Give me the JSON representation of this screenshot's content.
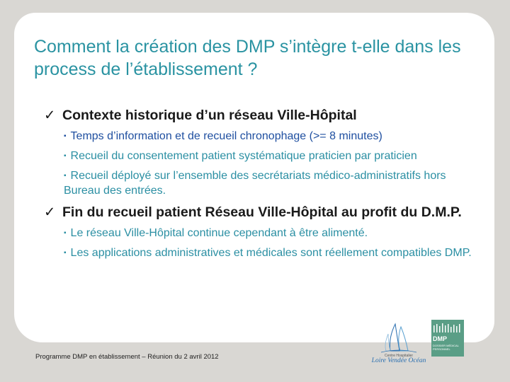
{
  "slide": {
    "title": "Comment la création des DMP s’intègre t-elle dans les process de l’établissement ?",
    "sections": [
      {
        "bullet": "✓",
        "heading": "Contexte historique d’un réseau Ville-Hôpital",
        "items": [
          "Temps d’information et de recueil chronophage (>= 8 minutes)",
          "Recueil du consentement patient systématique praticien par praticien",
          "Recueil déployé sur l’ensemble des secrétariats médico-administratifs hors Bureau des entrées."
        ]
      },
      {
        "bullet": "✓",
        "heading": "Fin du recueil patient Réseau Ville-Hôpital au profit du D.M.P.",
        "items": [
          "Le réseau Ville-Hôpital continue cependant à être alimenté.",
          "Les applications administratives et médicales sont réellement compatibles DMP."
        ]
      }
    ],
    "sub_bullet": "▪",
    "footer": "Programme DMP en établissement – Réunion du 2 avril 2012"
  },
  "logos": {
    "hospital": {
      "caption": "Centre Hospitalier",
      "name": "Loire Vendée Océan"
    },
    "dmp": {
      "text": "DMP",
      "subtitle": "DOSSIER MÉDICAL PERSONNEL"
    }
  },
  "colors": {
    "title": "#2a93a2",
    "sub_bullet_text": "#2b8fa3",
    "sub_bullet_text_highlight": "#1f4fa0",
    "dmp_logo": "#5a9e86",
    "background": "#d9d7d3"
  }
}
